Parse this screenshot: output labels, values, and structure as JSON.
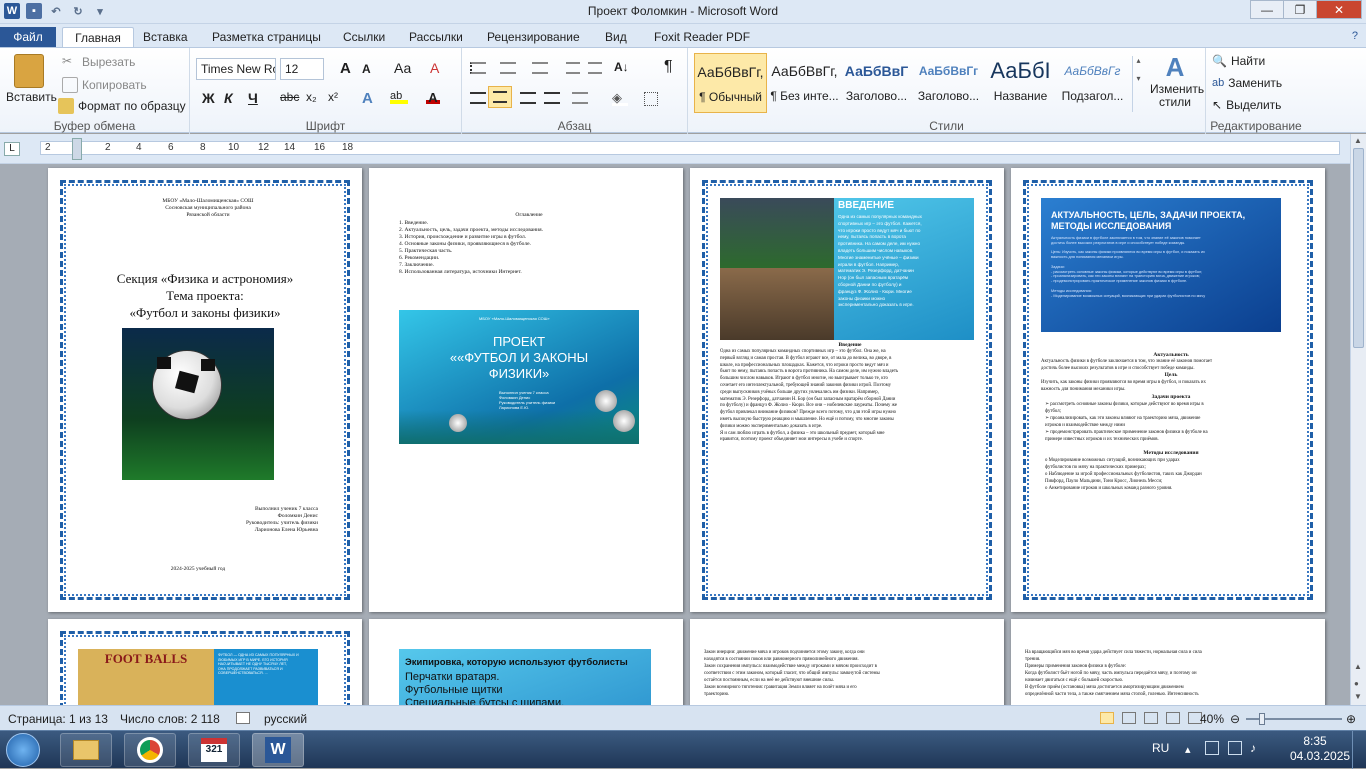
{
  "window": {
    "title": "Проект Фоломкин  -  Microsoft Word",
    "minimize": "—",
    "maximize": "❐",
    "close": "✕"
  },
  "tabs": [
    "Файл",
    "Главная",
    "Вставка",
    "Разметка страницы",
    "Ссылки",
    "Рассылки",
    "Рецензирование",
    "Вид",
    "Foxit Reader PDF"
  ],
  "ribbon": {
    "clipboard": {
      "label": "Буфер обмена",
      "paste": "Вставить",
      "cut": "Вырезать",
      "copy": "Копировать",
      "format_painter": "Формат по образцу"
    },
    "font": {
      "label": "Шрифт",
      "name": "Times New Ro",
      "size": "12",
      "bold": "Ж",
      "italic": "К",
      "underline": "Ч",
      "strike": "abc",
      "sub": "x₂",
      "sup": "x²",
      "grow": "A",
      "shrink": "A",
      "case": "Аа",
      "clear": "A"
    },
    "paragraph": {
      "label": "Абзац",
      "pilcrow": "¶"
    },
    "styles": {
      "label": "Стили",
      "items": [
        {
          "preview": "АаБбВвГг,",
          "name": "¶ Обычный",
          "color": "#222"
        },
        {
          "preview": "АаБбВвГг,",
          "name": "¶ Без инте...",
          "color": "#222"
        },
        {
          "preview": "АаБбВвГ",
          "name": "Заголово...",
          "color": "#2b5797"
        },
        {
          "preview": "АаБбВвГг",
          "name": "Заголово...",
          "color": "#4f81bd"
        },
        {
          "preview": "АаБбІ",
          "name": "Название",
          "color": "#17365d"
        },
        {
          "preview": "АаБбВвГг",
          "name": "Подзагол...",
          "color": "#4f81bd"
        }
      ],
      "change": "Изменить стили"
    },
    "editing": {
      "label": "Редактирование",
      "find": "Найти",
      "replace": "Заменить",
      "select": "Выделить"
    }
  },
  "ruler": {
    "numbers": [
      "2",
      "2",
      "4",
      "6",
      "8",
      "10",
      "12",
      "14",
      "16",
      "18"
    ]
  },
  "pages": {
    "p1": {
      "header": "МБОУ «Мало-Шаломищенская» СОШ\nСосновская  муниципального  района\nРязанской области",
      "title": "Секция «Физика и астрономия»\nТема проекта:\n«Футбол и законы физики»",
      "author": "Выполнил  ученик 7 класса\nФоломкин Денис\nРуководитель:  учитель физики\nЛарионова Елена Юрьевна",
      "year": "2024-2025  учебный год"
    },
    "p2": {
      "toc_title": "Оглавление",
      "toc": "1. Введение.\n2. Актуальность, цель, задачи проекта, методы исследования.\n3. История, происхождение и развитие игры в футбол.\n4. Основные законы физики, проявляющиеся в футболе.\n5. Практическая часть.\n6. Рекомендации.\n7. Заключение.\n8. Использованная литература, источники Интернет.",
      "slide_school": "МБОУ «Мало-Шаломищенская СОШ»",
      "slide_title": "ПРОЕКТ\n««ФУТБОЛ И ЗАКОНЫ\nФИЗИКИ»",
      "slide_sub": "Выполнил ученик 7 класса\nФоломкин Денис\nРуководитель учитель физики\nЛарионова Е.Ю."
    },
    "p3": {
      "slide_title": "ВВЕДЕНИЕ",
      "slide_text": "Одна из самых популярных командных\nспортивных игр – это футбол. Кажется,\nчто игроки просто ведут мяч и бьют по\nнему, пытаясь попасть в ворота\nпротивника. На самом деле, им нужно\nвладеть большим числом навыков.\nМногие знаменитые учёные – физики\nиграли в футбол. Например,\nматематик Э. Резерфорд, датчанин\nНор (он был  запасным вратарём\nсборной Дании по футболу) и\nфранцуз Ф. Жолио - Кюри. Многие\nзаконы физики можно\nэкспериментально доказать в игре.",
      "heading": "Введение",
      "body": "Одна из самых популярных командных спортивных игр – это футбол. Она же, на\nпервый взгляд и самая простая. В футбол играют все, от мала до велика, во дворе, в\nшколе, на профессиональных площадках.  Кажется, что игроки просто ведут мяч и\nбьют по нему, пытаясь попасть в ворота противника. На самом деле, им нужно владеть\nбольшим числом навыков. Играют в футбол многие, но выигрывает только те, кто\nсочетает его интеллектуальной, требующей знаний законов физики игрой. Поэтому\nсреди выпускников учёных больше других увлекались им физики. Например,\nматематик Э. Резерфорд, датчанин Н. Бор (он был запасным вратарём сборной Дании\nпо футболу) и француз Ф. Жолио - Кюри. Все они – нобелевские лауреаты. Почему же\nфутбол привлекал внимание физиков? Прежде всего потому, что для этой игры нужно\nиметь высокую быструю реакцию и мышление. Но ещё и потому, что многие законы\nфизики можно экспериментально доказать в игре.\n   Я и сам люблю играть в футбол, а физика – это школьный предмет, который мне\nнравится, поэтому проект объединяет мои интересы в учебе и спорте."
    },
    "p4": {
      "slide_title": "АКТУАЛЬНОСТЬ, ЦЕЛЬ, ЗАДАЧИ ПРОЕКТА,\nМЕТОДЫ ИССЛЕДОВАНИЯ",
      "slide_text": "Актуальность физики в футболе заключается в том, что знание её законов помогает\nдостичь более высоких результатов в игре и способствует победе команды.\n\nЦель: Изучить, как законы физики проявляются во время игры в футбол, и показать их\nважность для понимания механики игры.\n\nЗадачи:\n- рассмотреть основные законы физики, которые действуют во время игры в футбол;\n- проанализировать, как эти законы влияют на траекторию мяча, движение игроков;\n- продемонстрировать практическое применение законов физики в футболе.\n\nМетоды исследования:\n- Моделирование возможных ситуаций, возникающих при ударах футболистов по мячу",
      "h1": "Актуальность",
      "t1": "Актуальность физики в футболе заключается в том, что знание её законов помогает\nдостичь более высоких результатов в игре и способствует победе команды.",
      "h2": "Цель",
      "t2": "Изучить, как законы физики проявляются во время игры в футбол, и показать их\nважность для понимания механики игры.",
      "h3": "Задачи проекта",
      "t3": "➢  рассмотреть основные законы физики, которые действуют во время игры в\n    футбол;\n➢  проанализировать, как эти законы влияют на траекторию мяча, движение\n    игроков и взаимодействие между ними\n➢  продемонстрировать практическое применение      законов физики в футболе на\n    примере известных игроков и их технических приёмов.",
      "h4": "Методы исследования",
      "t4": "o  Моделирование  возможных  ситуаций,  возникающих  при  ударах\n    футболистов по мячу на практических примерах;\no  Наблюдение за игрой профессиональных футболистов, таких как Джордан\n    Пикфорд, Пауло Мальдини, Тони Кросс, Лионель Месси;\no  Анкетирование игроков и школьных команд разного уровня."
    },
    "p5": {
      "poster": "FOOT BALLS",
      "slide_text": "ФУТБОЛ — ОДНА ИЗ САМЫХ ПОПУЛЯРНЫХ И\nЛЮБИМЫХ ИГР В МИРЕ. ЕГО ИСТОРИЯ\nНАСЧИТЫВАЕТ НЕ ОДНУ ТЫСЯЧУ ЛЕТ,\nОНА ПРОДОЛЖАЕТ РАЗВИВАТЬСЯ И\nСОВЕРШЕНСТВОВАТЬСЯ. ..."
    },
    "p6": {
      "slide_title": "Экипировка, которую используют футболисты",
      "slide_items": "Перчатки вратаря.\nФутбольные щитки\nСпециальные бутсы с шипами."
    },
    "p7": {
      "body": "Закон инерции:  движение мяча и игроков подчиняется этому закону, когда они\nнаходятся в состоянии покоя или равномерного  прямолинейного  движения.\nЗакон сохранения импульса: взаимодействие между игроками и мячом происходит в\nсоответствии с этим законом, который гласит, что общий импульс замкнутой системы\nостаётся постоянным, если на неё не действуют внешние силы.\nЗакон всемирного тяготения: гравитация Земли влияет на полёт мяча и его\nтраекторию."
    },
    "p8": {
      "body": "На вращающийся мяч во время удара действует сила тяжести, нормальная сила и сила\nтрения.\n                    Примеры применения законов физики в футболе:\nКогда  футболист бьёт ногой по мячу, часть импульса передаётся мячу, и поэтому он\nначинает двигаться с ещё с большей скоростью.\nВ футболе приём (остановка) мяча достигается амортизирующим движением\nопределённой части тела, а также смягчением мяча стопой, голенью. Интенсивность"
    }
  },
  "status": {
    "page": "Страница: 1 из 13",
    "words": "Число слов: 2 118",
    "lang": "русский",
    "zoom": "40%",
    "zoom_level": 40
  },
  "taskbar": {
    "lang": "RU",
    "time": "8:35",
    "date": "04.03.2025"
  }
}
